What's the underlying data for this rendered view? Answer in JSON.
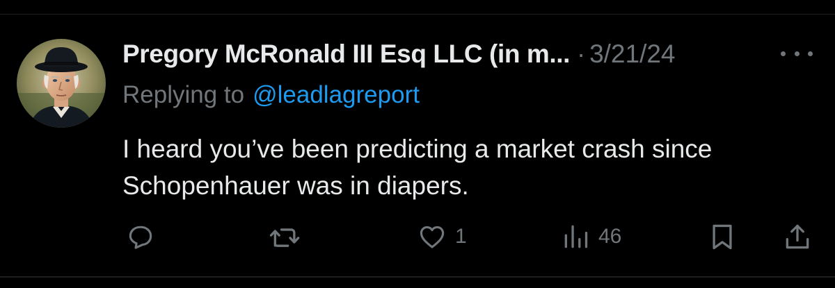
{
  "post": {
    "author": {
      "display_name": "Pregory McRonald III Esq LLC (in m...",
      "avatar_icon": "avatar-portrait-top-hat"
    },
    "separator": "·",
    "timestamp": "3/21/24",
    "reply": {
      "prefix": "Replying to",
      "handle": "@leadlagreport"
    },
    "text_lines": [
      "I heard you’ve been predicting a market crash since",
      "Schopenhauer was in diapers."
    ],
    "more_icon": "more-horizontal-icon",
    "actions": {
      "reply": {
        "icon": "reply-icon",
        "count": ""
      },
      "repost": {
        "icon": "repost-icon",
        "count": ""
      },
      "like": {
        "icon": "heart-icon",
        "count": "1"
      },
      "views": {
        "icon": "views-bar-chart-icon",
        "count": "46"
      },
      "bookmark": {
        "icon": "bookmark-icon"
      },
      "share": {
        "icon": "share-icon"
      }
    }
  },
  "colors": {
    "background": "#000000",
    "primary_text": "#e7e9ea",
    "secondary_text": "#71767b",
    "link": "#1d9bf0",
    "divider": "#1e1e1e"
  }
}
